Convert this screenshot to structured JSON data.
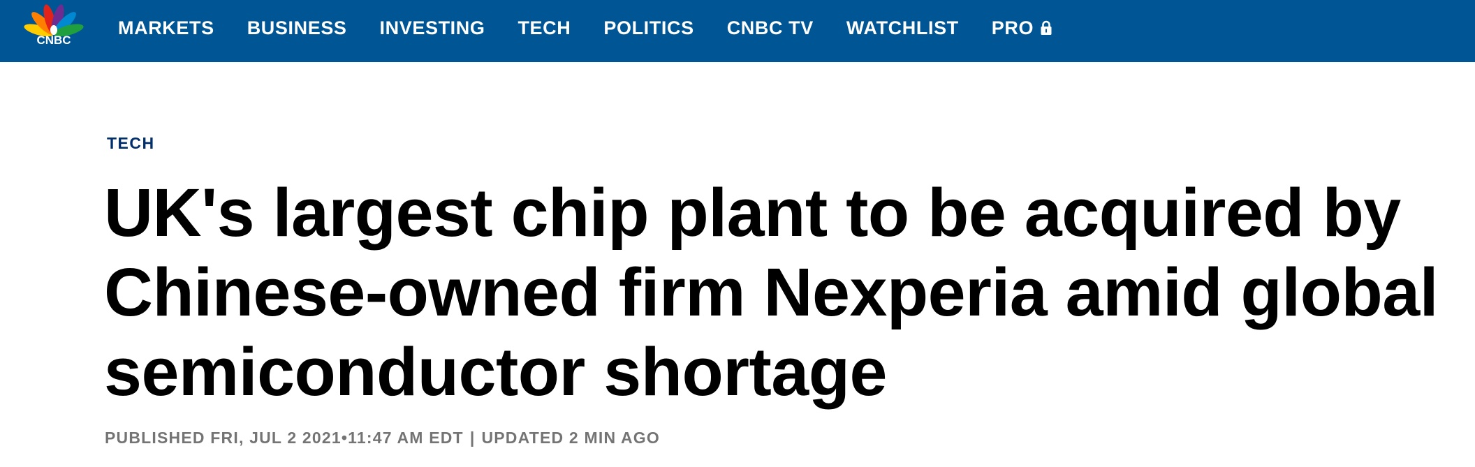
{
  "header": {
    "logo_text": "CNBC",
    "background_color": "#005594",
    "nav": [
      {
        "label": "MARKETS"
      },
      {
        "label": "BUSINESS"
      },
      {
        "label": "INVESTING"
      },
      {
        "label": "TECH"
      },
      {
        "label": "POLITICS"
      },
      {
        "label": "CNBC TV"
      },
      {
        "label": "WATCHLIST"
      },
      {
        "label": "PRO",
        "icon": "lock-icon"
      }
    ]
  },
  "article": {
    "category": "TECH",
    "category_color": "#002f6c",
    "headline": "UK's largest chip plant to be acquired by Chinese-owned firm Nexperia amid global semiconductor shortage",
    "published": "PUBLISHED FRI, JUL 2 2021•11:47 AM EDT",
    "separator": "|",
    "updated": "UPDATED 2 MIN AGO"
  }
}
